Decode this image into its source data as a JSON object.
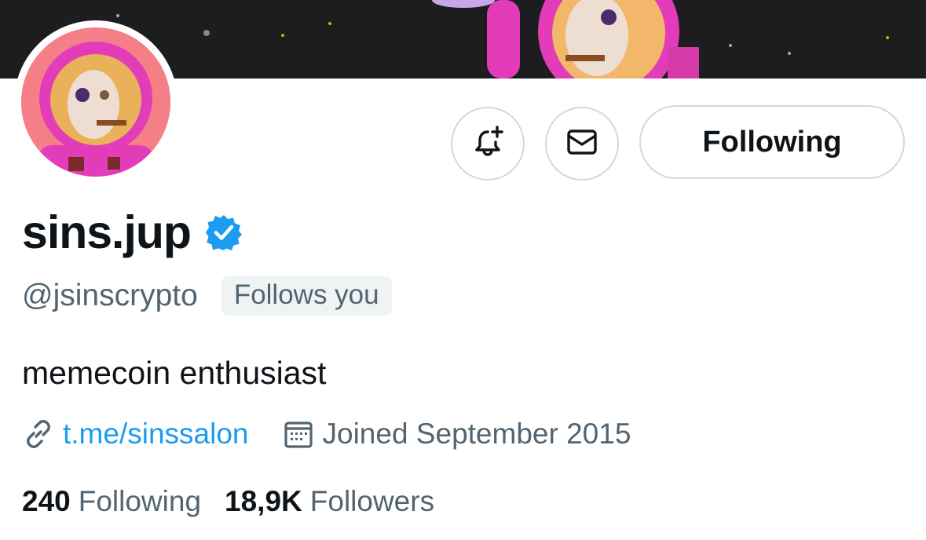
{
  "profile": {
    "display_name": "sins.jup",
    "handle": "@jsinscrypto",
    "follows_you_badge": "Follows you",
    "bio": "memecoin enthusiast",
    "verified_icon": "verified-badge-icon",
    "verified_color": "#1d9bf0"
  },
  "actions": {
    "notify_icon": "bell-plus-icon",
    "message_icon": "envelope-icon",
    "following_label": "Following"
  },
  "meta": {
    "link_icon": "link-icon",
    "link_text": "t.me/sinssalon",
    "joined_icon": "calendar-icon",
    "joined_text": "Joined September 2015"
  },
  "stats": {
    "following_count": "240",
    "following_label": "Following",
    "followers_count": "18,9K",
    "followers_label": "Followers"
  },
  "colors": {
    "accent": "#1d9bf0",
    "secondary_text": "#536471",
    "avatar_background": "#f47f86",
    "banner_background": "#1d1d1f"
  }
}
